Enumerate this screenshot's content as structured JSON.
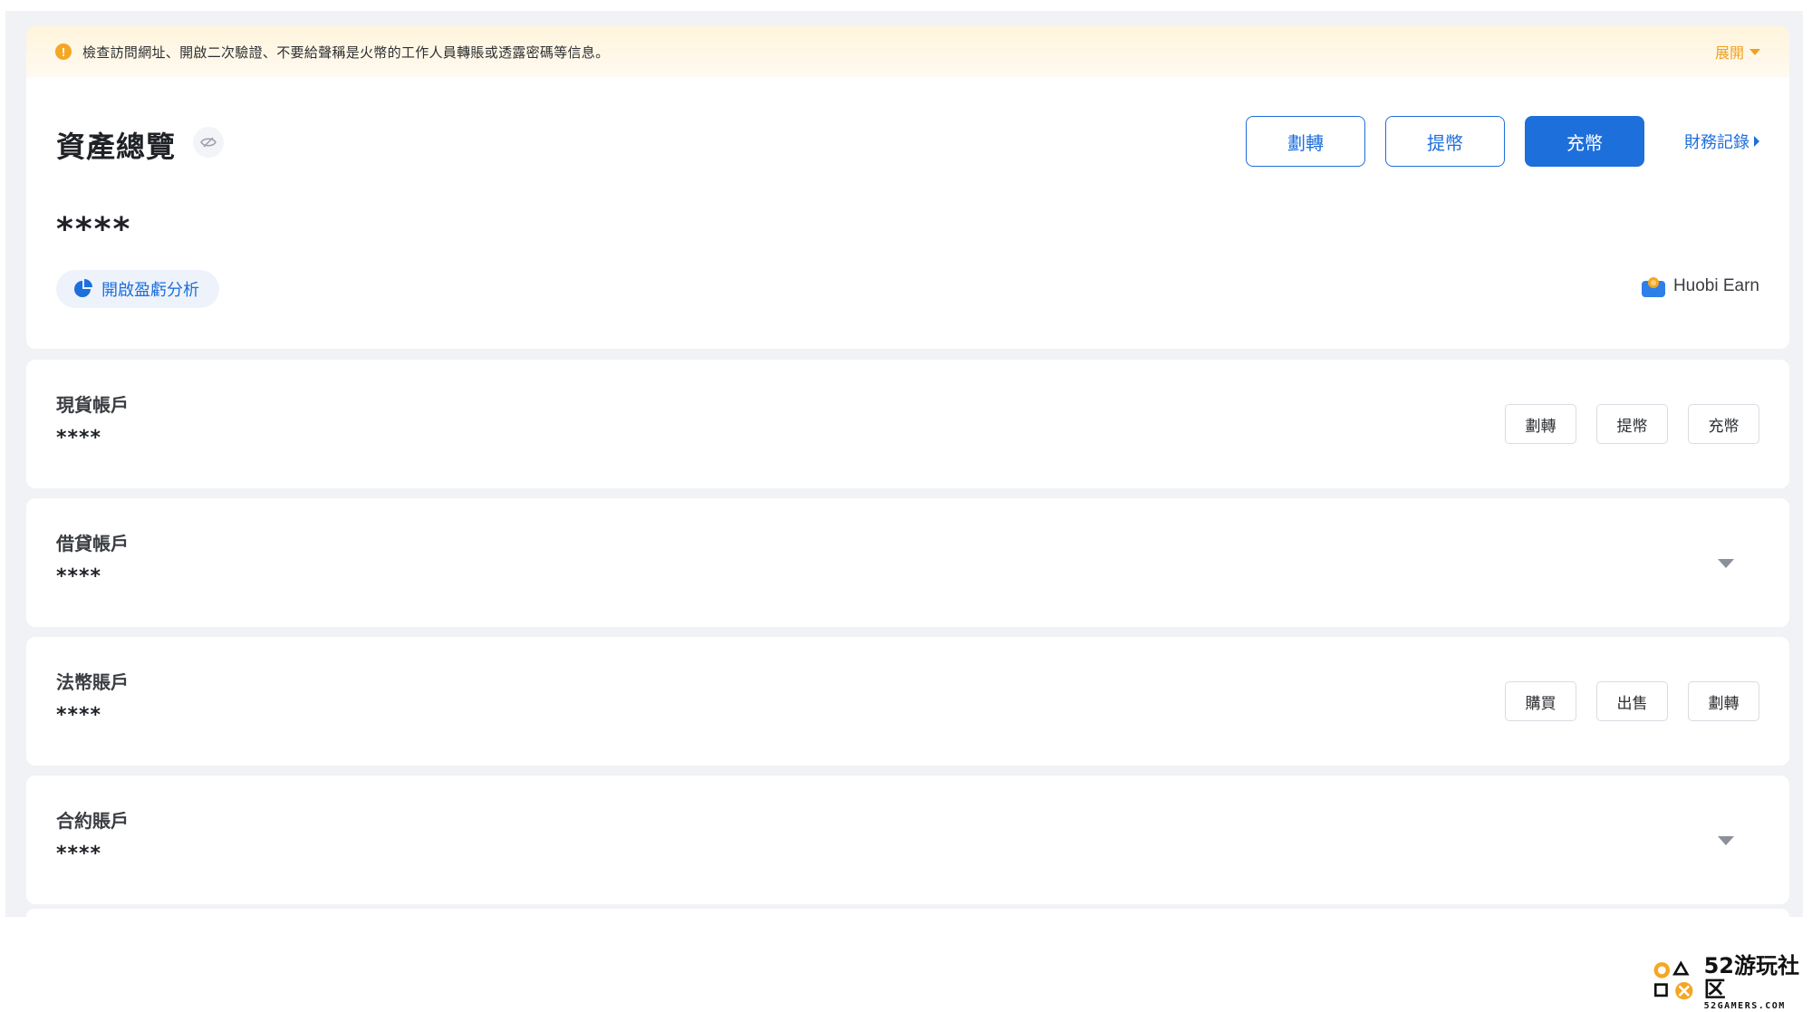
{
  "notice": {
    "text": "檢查訪問網址、開啟二次驗證、不要給聲稱是火幣的工作人員轉賬或透露密碼等信息。",
    "expand_label": "展開",
    "icon": "exclamation-icon",
    "icon_glyph": "!"
  },
  "overview": {
    "title": "資產總覽",
    "hidden_value": "****",
    "actions": {
      "transfer": "劃轉",
      "withdraw": "提幣",
      "deposit": "充幣",
      "finance_records": "財務記錄"
    },
    "pnl_button": "開啟盈虧分析",
    "earn_label": "Huobi Earn"
  },
  "accounts": [
    {
      "name": "現貨帳戶",
      "value": "****",
      "actions": [
        "劃轉",
        "提幣",
        "充幣"
      ]
    },
    {
      "name": "借貸帳戶",
      "value": "****",
      "collapsible": true
    },
    {
      "name": "法幣賬戶",
      "value": "****",
      "actions": [
        "購買",
        "出售",
        "劃轉"
      ]
    },
    {
      "name": "合約賬戶",
      "value": "****",
      "collapsible": true
    }
  ],
  "watermark": {
    "main": "52游玩社区",
    "sub": "52GAMERS.COM"
  },
  "colors": {
    "primary": "#1d6fdb",
    "warning": "#f5a623",
    "background": "#f0f2f5"
  }
}
